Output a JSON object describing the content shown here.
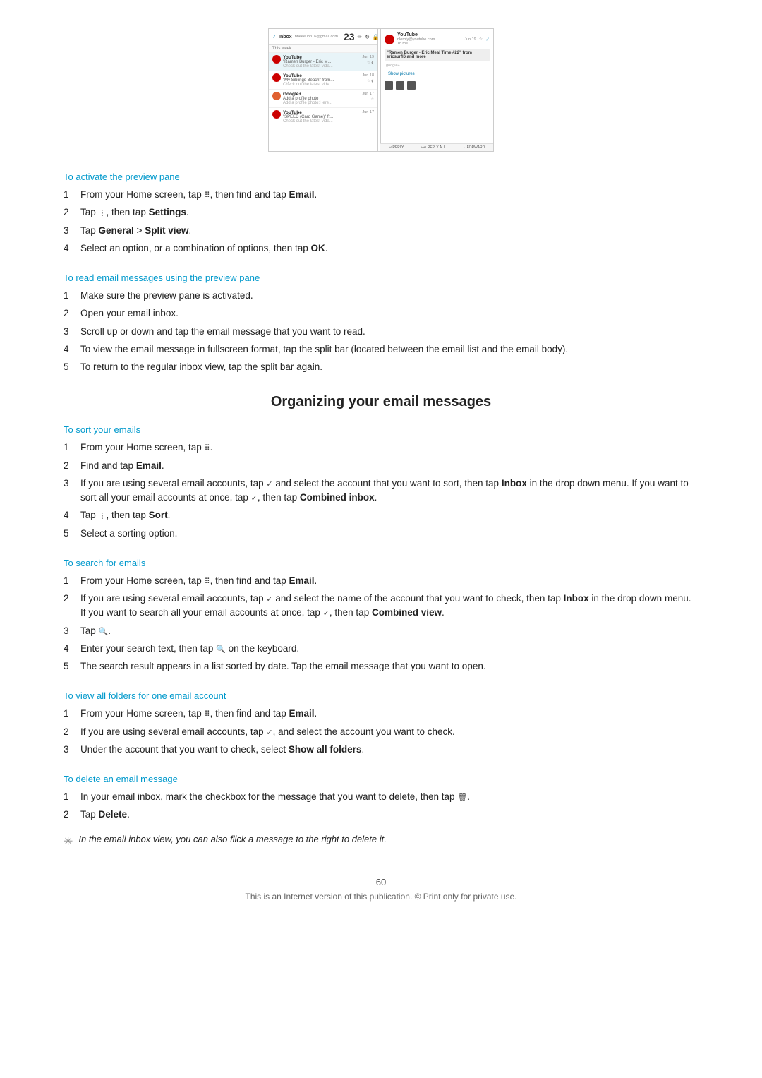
{
  "screenshot": {
    "alt": "Email app screenshot showing inbox with preview pane"
  },
  "sections": [
    {
      "id": "activate-preview",
      "header": "To activate the preview pane",
      "steps": [
        {
          "num": "1",
          "text": "From your Home screen, tap ",
          "bold_parts": [
            "Email"
          ],
          "rest": ".",
          "inline": "then find and tap "
        },
        {
          "num": "2",
          "text": "Tap ",
          "bold_parts": [
            "Settings"
          ],
          "rest": ".",
          "inline": "then tap "
        },
        {
          "num": "3",
          "text": "Tap ",
          "bold_parts": [
            "General",
            "Split view"
          ],
          "rest": ".",
          "inline": " > ",
          "prefix": "General > Split view"
        },
        {
          "num": "4",
          "text": "Select an option, or a combination of options, then tap ",
          "bold_parts": [
            "OK"
          ],
          "rest": "."
        }
      ]
    },
    {
      "id": "read-preview",
      "header": "To read email messages using the preview pane",
      "steps": [
        {
          "num": "1",
          "text": "Make sure the preview pane is activated."
        },
        {
          "num": "2",
          "text": "Open your email inbox."
        },
        {
          "num": "3",
          "text": "Scroll up or down and tap the email message that you want to read."
        },
        {
          "num": "4",
          "text": "To view the email message in fullscreen format, tap the split bar (located between the email list and the email body)."
        },
        {
          "num": "5",
          "text": "To return to the regular inbox view, tap the split bar again."
        }
      ]
    }
  ],
  "organizing_section": {
    "title": "Organizing your email messages",
    "subsections": [
      {
        "id": "sort-emails",
        "header": "To sort your emails",
        "steps": [
          {
            "num": "1",
            "html": "From your Home screen, tap ⠿."
          },
          {
            "num": "2",
            "html": "Find and tap <b>Email</b>."
          },
          {
            "num": "3",
            "html": "If you are using several email accounts, tap ✓ and select the account that you want to sort, then tap <b>Inbox</b> in the drop down menu. If you want to sort all your email accounts at once, tap ✓, then tap <b>Combined inbox</b>."
          },
          {
            "num": "4",
            "html": "Tap ⋮, then tap <b>Sort</b>."
          },
          {
            "num": "5",
            "html": "Select a sorting option."
          }
        ]
      },
      {
        "id": "search-emails",
        "header": "To search for emails",
        "steps": [
          {
            "num": "1",
            "html": "From your Home screen, tap ⠿, then find and tap <b>Email</b>."
          },
          {
            "num": "2",
            "html": "If you are using several email accounts, tap ✓ and select the name of the account that you want to check, then tap <b>Inbox</b> in the drop down menu. If you want to search all your email accounts at once, tap ✓, then tap <b>Combined view</b>."
          },
          {
            "num": "3",
            "html": "Tap 🔍."
          },
          {
            "num": "4",
            "html": "Enter your search text, then tap 🔍 on the keyboard."
          },
          {
            "num": "5",
            "html": "The search result appears in a list sorted by date. Tap the email message that you want to open."
          }
        ]
      },
      {
        "id": "view-folders",
        "header": "To view all folders for one email account",
        "steps": [
          {
            "num": "1",
            "html": "From your Home screen, tap ⠿, then find and tap <b>Email</b>."
          },
          {
            "num": "2",
            "html": "If you are using several email accounts, tap ✓, and select the account you want to check."
          },
          {
            "num": "3",
            "html": "Under the account that you want to check, select <b>Show all folders</b>."
          }
        ]
      },
      {
        "id": "delete-email",
        "header": "To delete an email message",
        "steps": [
          {
            "num": "1",
            "html": "In your email inbox, mark the checkbox for the message that you want to delete, then tap 🗑."
          },
          {
            "num": "2",
            "html": "Tap <b>Delete</b>."
          }
        ],
        "tip": "In the email inbox view, you can also flick a message to the right to delete it."
      }
    ]
  },
  "footer": {
    "page_number": "60",
    "copyright": "This is an Internet version of this publication. © Print only for private use."
  }
}
